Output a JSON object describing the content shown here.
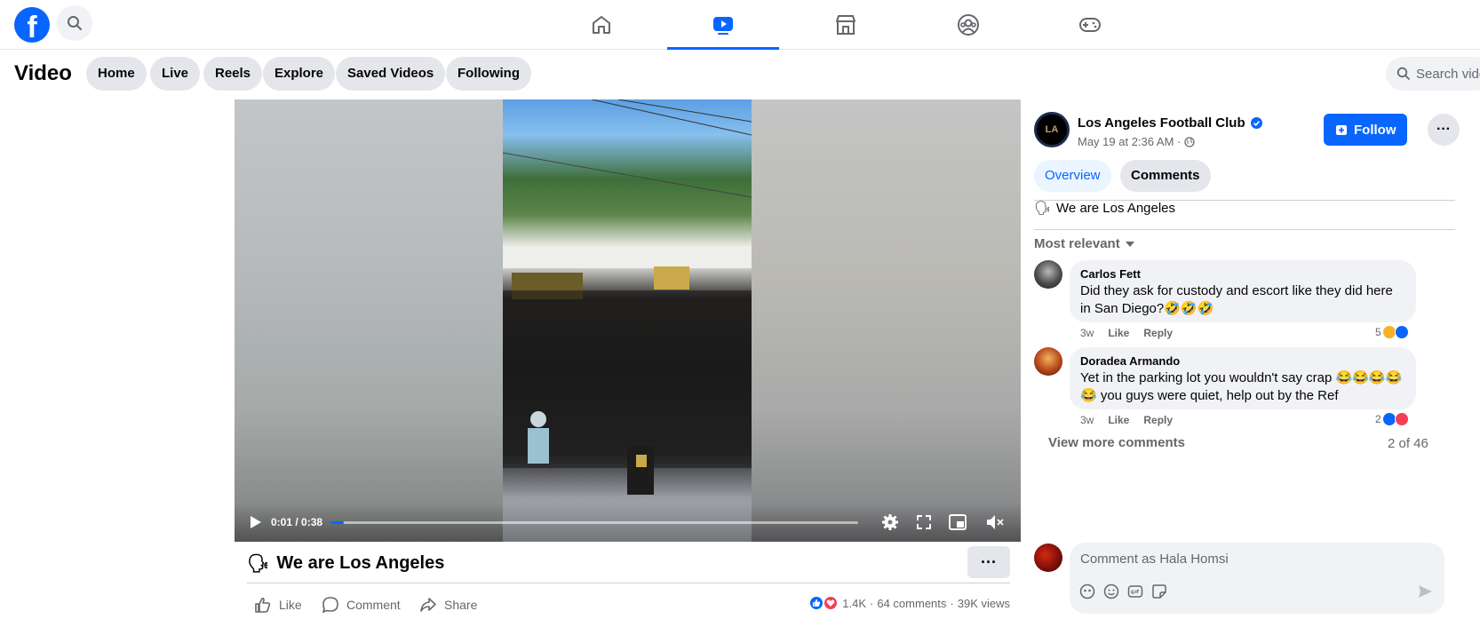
{
  "brand": {
    "logo_letter": "f",
    "color": "#0866ff"
  },
  "topnav": {
    "tabs": [
      {
        "name": "home",
        "icon": "home-icon"
      },
      {
        "name": "video",
        "icon": "video-icon",
        "active": true
      },
      {
        "name": "marketplace",
        "icon": "marketplace-icon"
      },
      {
        "name": "groups",
        "icon": "groups-icon"
      },
      {
        "name": "gaming",
        "icon": "gaming-icon"
      }
    ]
  },
  "subnav": {
    "title": "Video",
    "chips": [
      "Home",
      "Live",
      "Reels",
      "Explore",
      "Saved Videos",
      "Following"
    ],
    "search_placeholder": "Search vide"
  },
  "player": {
    "time": "0:01 / 0:38",
    "progress_fraction": 0.026,
    "buffered_fraction": 0.93
  },
  "post": {
    "title_emoji": "🗣",
    "title": "We are Los Angeles",
    "more_label": "···",
    "actions": {
      "like": "Like",
      "comment": "Comment",
      "share": "Share"
    },
    "stats": {
      "reactions": "1.4K",
      "dot1": "·",
      "comments": "64 comments",
      "dot2": "·",
      "views": "39K views"
    }
  },
  "sidebar": {
    "page_name": "Los Angeles Football Club",
    "avatar_text": "LA",
    "post_time": "May 19 at 2:36 AM ·",
    "follow_label": "Follow",
    "more_label": "···",
    "tabs": {
      "overview": "Overview",
      "comments": "Comments"
    },
    "caption_emoji": "🗣",
    "caption": "We are Los Angeles",
    "sort_label": "Most relevant",
    "comments": [
      {
        "author": "Carlos Fett",
        "text": "Did they ask for custody and escort like they did here in San Diego?🤣🤣🤣",
        "time": "3w",
        "like": "Like",
        "reply": "Reply",
        "reaction_count": "5"
      },
      {
        "author": "Doradea Armando",
        "text": "Yet in the parking lot you wouldn't say crap 😂😂😂😂 😂 you guys were quiet, help out by the Ref",
        "time": "3w",
        "like": "Like",
        "reply": "Reply",
        "reaction_count": "2"
      }
    ],
    "view_more": "View more comments",
    "counter": "2 of 46",
    "comment_placeholder": "Comment as Hala Homsi"
  }
}
